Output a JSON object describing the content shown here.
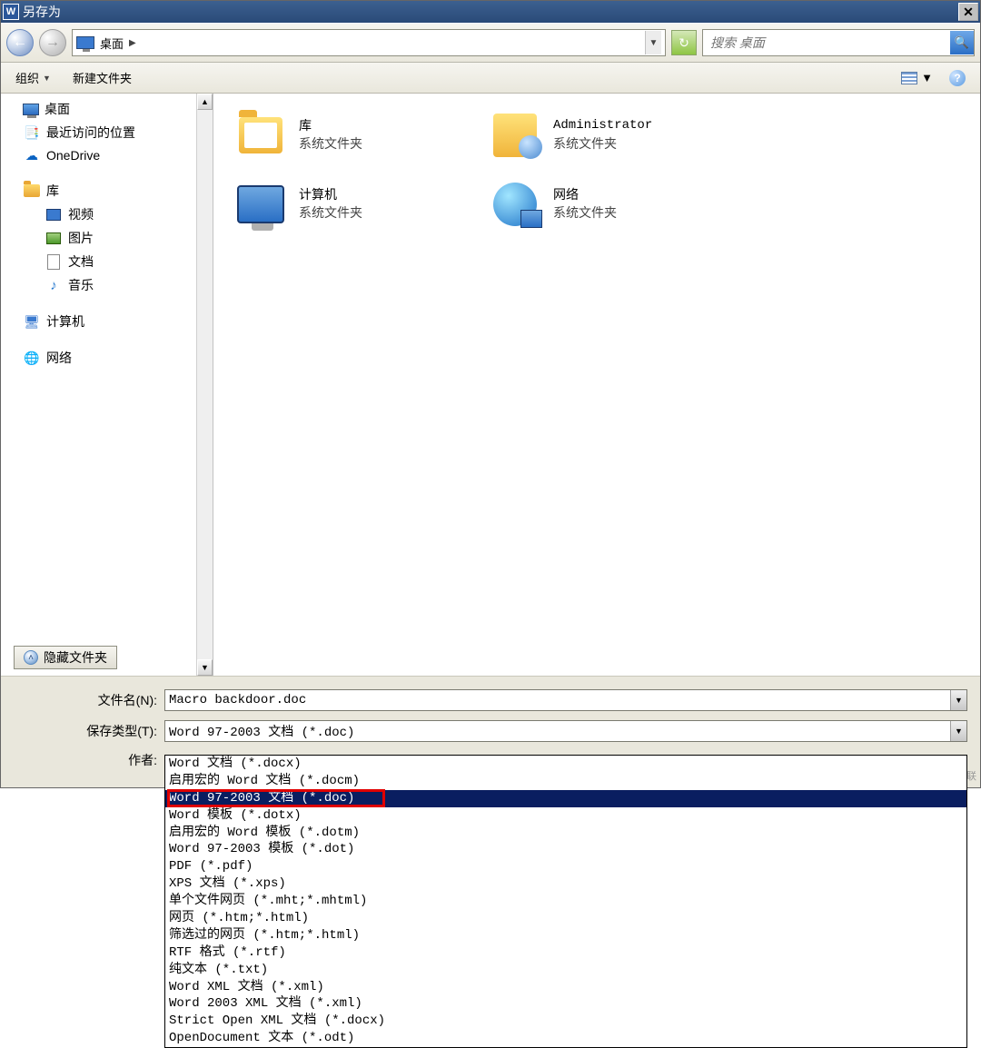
{
  "titlebar": {
    "title": "另存为"
  },
  "nav": {
    "location": "桌面",
    "search_placeholder": "搜索 桌面"
  },
  "toolbar": {
    "organize": "组织",
    "newfolder": "新建文件夹"
  },
  "tree": {
    "desktop": "桌面",
    "recent": "最近访问的位置",
    "onedrive": "OneDrive",
    "lib": "库",
    "video": "视频",
    "pic": "图片",
    "doc": "文档",
    "music": "音乐",
    "computer": "计算机",
    "network": "网络"
  },
  "main": {
    "lib": {
      "title": "库",
      "sub": "系统文件夹"
    },
    "admin": {
      "title": "Administrator",
      "sub": "系统文件夹"
    },
    "pc": {
      "title": "计算机",
      "sub": "系统文件夹"
    },
    "net": {
      "title": "网络",
      "sub": "系统文件夹"
    }
  },
  "footer": {
    "filename_label": "文件名(N):",
    "filename_value": "Macro backdoor.doc",
    "filetype_label": "保存类型(T):",
    "filetype_value": "Word 97-2003 文档 (*.doc)",
    "author_label": "作者:",
    "hide": "隐藏文件夹"
  },
  "options": [
    "Word 文档 (*.docx)",
    "启用宏的 Word 文档 (*.docm)",
    "Word 97-2003 文档 (*.doc)",
    "Word 模板 (*.dotx)",
    "启用宏的 Word 模板 (*.dotm)",
    "Word 97-2003 模板 (*.dot)",
    "PDF (*.pdf)",
    "XPS 文档 (*.xps)",
    "单个文件网页 (*.mht;*.mhtml)",
    "网页 (*.htm;*.html)",
    "筛选过的网页 (*.htm;*.html)",
    "RTF 格式 (*.rtf)",
    "纯文本 (*.txt)",
    "Word XML 文档 (*.xml)",
    "Word 2003 XML 文档 (*.xml)",
    "Strict Open XML 文档 (*.docx)",
    "OpenDocument 文本 (*.odt)"
  ],
  "watermark": "创新互联"
}
